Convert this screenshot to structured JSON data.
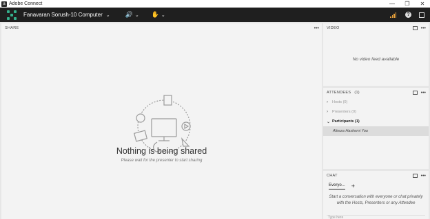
{
  "window": {
    "title": "Adobe Connect",
    "app_icon_letter": "a",
    "min_glyph": "—",
    "restore_glyph": "❐",
    "close_glyph": "✕"
  },
  "menubar": {
    "room_name": "Fanavaran Sorush-10 Computer",
    "chevron": "⌄",
    "speaker_glyph": "🔊",
    "hand_glyph": "✋",
    "help_glyph": "?",
    "signal_color": "#e9a23b",
    "logo_color": "#34b08d"
  },
  "share_pod": {
    "title": "SHARE",
    "more": "•••",
    "heading": "Nothing is being shared",
    "subtext": "Please wait for the presenter to start sharing",
    "illustration": "share-illustration"
  },
  "video_pod": {
    "title": "VIDEO",
    "more": "•••",
    "message": "No video feed available"
  },
  "attendees_pod": {
    "title": "ATTENDEES",
    "count": "(1)",
    "more": "•••",
    "groups": [
      {
        "label": "Hosts (0)",
        "arrow": "›",
        "open": false
      },
      {
        "label": "Presenters (0)",
        "arrow": "›",
        "open": false
      },
      {
        "label": "Participants (1)",
        "arrow": "⌄",
        "open": true
      }
    ],
    "participant": "Alireza Hashemi You"
  },
  "chat_pod": {
    "title": "CHAT",
    "more": "•••",
    "tab_label": "Everyo...",
    "add_tab": "+",
    "message": "Start a conversation with everyone or chat privately with the Hosts, Presenters or any Attendee",
    "input_placeholder": "Type here"
  }
}
